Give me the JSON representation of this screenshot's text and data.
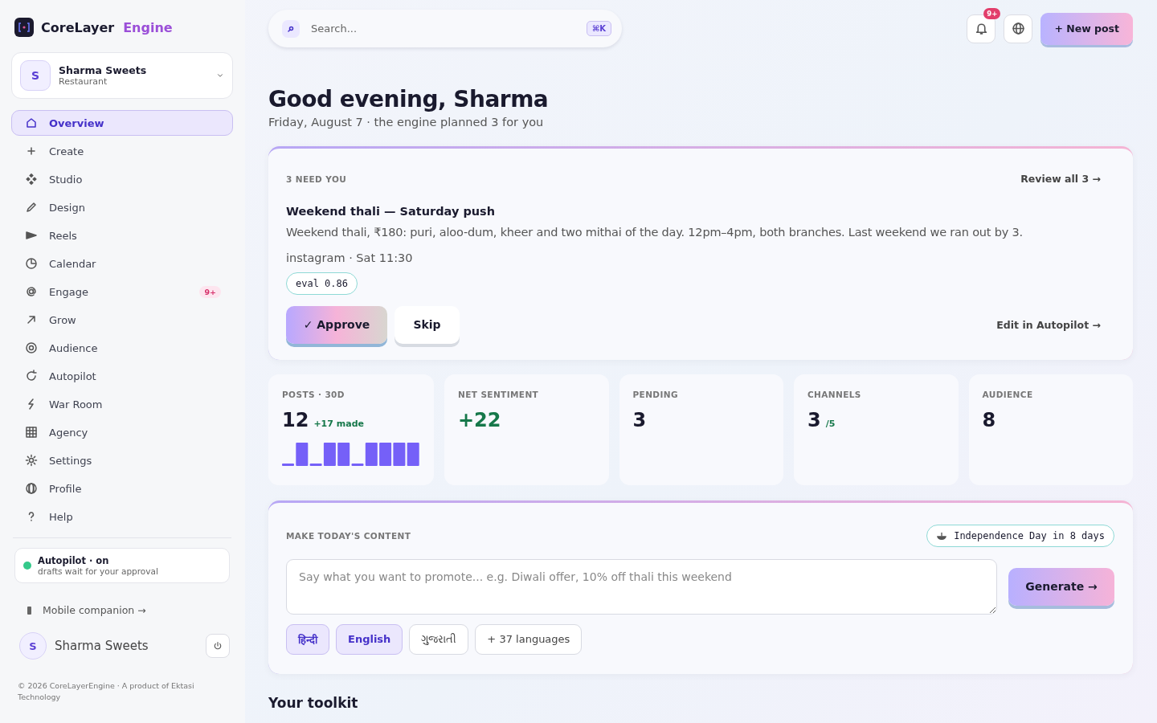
{
  "brand": {
    "name": "CoreLayer",
    "accent": "Engine"
  },
  "account": {
    "initial": "S",
    "name": "Sharma Sweets",
    "type": "Restaurant"
  },
  "nav": [
    {
      "label": "Overview",
      "selected": true
    },
    {
      "label": "Create",
      "selected": false
    },
    {
      "label": "Studio",
      "selected": false
    },
    {
      "label": "Design",
      "selected": false
    },
    {
      "label": "Reels",
      "selected": false
    },
    {
      "label": "Calendar",
      "selected": false
    },
    {
      "label": "Engage",
      "selected": false,
      "badge": "9+"
    },
    {
      "label": "Grow",
      "selected": false
    },
    {
      "label": "Audience",
      "selected": false
    },
    {
      "label": "Autopilot",
      "selected": false
    },
    {
      "label": "War Room",
      "selected": false
    },
    {
      "label": "Agency",
      "selected": false
    },
    {
      "label": "Settings",
      "selected": false
    },
    {
      "label": "Profile",
      "selected": false
    },
    {
      "label": "Help",
      "selected": false
    }
  ],
  "autopilot": {
    "title": "Autopilot · on",
    "subtitle": "drafts wait for your approval",
    "on": true
  },
  "mobile_link": "Mobile companion →",
  "user": {
    "initial": "S",
    "name": "Sharma Sweets"
  },
  "footer": "© 2026 CoreLayerEngine · A product of Ektasi Technology",
  "search": {
    "placeholder": "Search...",
    "shortcut": "⌘K"
  },
  "notifications_badge": "9+",
  "new_post": "+ New post",
  "greeting": {
    "title": "Good evening, Sharma",
    "subtitle": "Friday, August 7 · the engine planned 3 for you"
  },
  "review": {
    "label": "3 NEED YOU",
    "link": "Review all 3 →",
    "title": "Weekend thali — Saturday push",
    "body": "Weekend thali, ₹180: puri, aloo-dum, kheer and two mithai of the day. 12pm–4pm, both branches. Last weekend we ran out by 3.",
    "meta": "instagram · Sat 11:30",
    "eval": "eval 0.86",
    "approve": "✓ Approve",
    "skip": "Skip",
    "edit_link": "Edit in Autopilot →"
  },
  "stats": [
    {
      "label": "POSTS · 30D",
      "value": "12",
      "note": "+17 made",
      "kind": "bars"
    },
    {
      "label": "NET SENTIMENT",
      "value": "+22",
      "kind": "positive"
    },
    {
      "label": "PENDING",
      "value": "3",
      "kind": "plain"
    },
    {
      "label": "CHANNELS",
      "value": "3",
      "note": "/5",
      "kind": "plain"
    },
    {
      "label": "AUDIENCE",
      "value": "8",
      "kind": "plain"
    }
  ],
  "compose": {
    "label": "MAKE TODAY'S CONTENT",
    "event": "Independence Day in 8 days",
    "placeholder": "Say what you want to promote... e.g. Diwali offer, 10% off thali this weekend",
    "generate": "Generate →",
    "languages": [
      {
        "label": "हिन्दी",
        "selected": true
      },
      {
        "label": "English",
        "selected": true
      },
      {
        "label": "ગુજરાતી",
        "selected": false
      },
      {
        "label": "+ 37 languages",
        "selected": false
      }
    ]
  },
  "toolkit_title": "Your toolkit"
}
